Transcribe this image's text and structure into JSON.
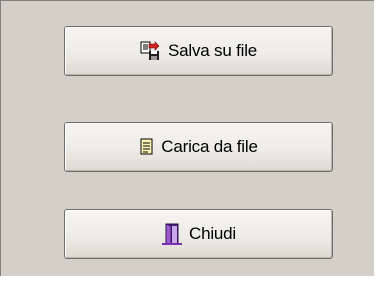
{
  "buttons": {
    "save": {
      "label": "Salva su file",
      "icon": "save-to-file-icon"
    },
    "load": {
      "label": "Carica da file",
      "icon": "load-from-file-icon"
    },
    "close": {
      "label": "Chiudi",
      "icon": "exit-door-icon"
    }
  },
  "colors": {
    "panel_background": "#d4d0c8",
    "button_border": "#6e6e6e",
    "icon_accent_red": "#cc2222",
    "icon_accent_purple": "#7a2fb3"
  }
}
